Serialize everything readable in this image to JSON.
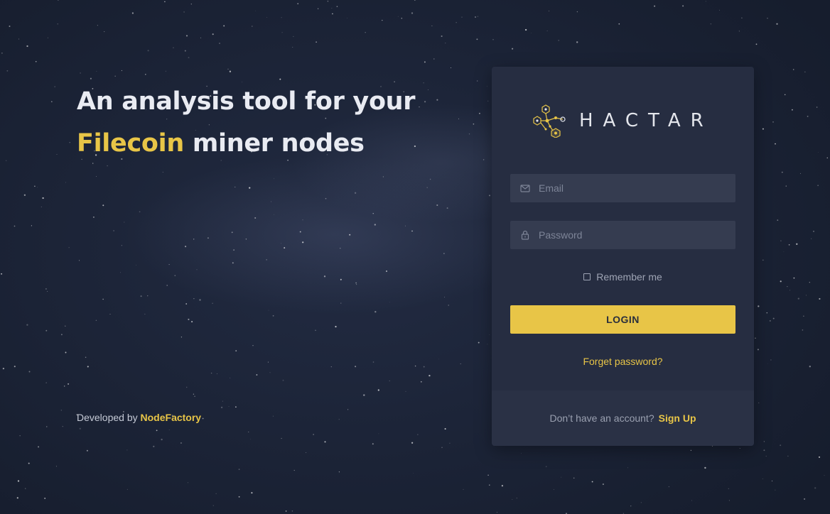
{
  "hero": {
    "line1": "An analysis tool for your",
    "accent": "Filecoin",
    "line2_rest": " miner nodes"
  },
  "footer_credit": {
    "prefix": "Developed by ",
    "brand": "NodeFactory"
  },
  "login_card": {
    "logo_text": "HACTAR",
    "email_placeholder": "Email",
    "password_placeholder": "Password",
    "remember_label": "Remember me",
    "login_button": "LOGIN",
    "forgot_password": "Forget password?",
    "no_account_text": "Don’t have an account?",
    "signup_link": "Sign Up"
  },
  "colors": {
    "accent": "#e8c547",
    "card_bg": "#262d41",
    "input_bg": "#353c50",
    "page_bg": "#1b2336"
  }
}
